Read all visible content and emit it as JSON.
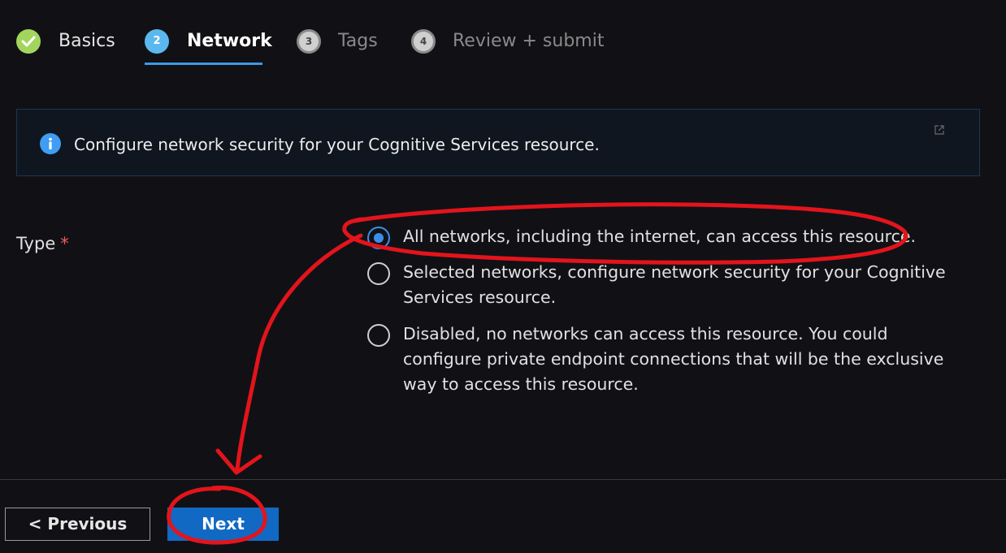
{
  "wizard": {
    "tabs": [
      {
        "label": "Basics",
        "step": "",
        "state": "completed"
      },
      {
        "label": "Network",
        "step": "2",
        "state": "active"
      },
      {
        "label": "Tags",
        "step": "3",
        "state": "upcoming"
      },
      {
        "label": "Review + submit",
        "step": "4",
        "state": "upcoming"
      }
    ]
  },
  "info_banner": {
    "text": "Configure network security for your Cognitive Services resource.",
    "icon": "info-icon",
    "link_icon": "external-link-icon"
  },
  "type_field": {
    "label": "Type",
    "required_marker": "*",
    "options": [
      {
        "label": "All networks, including the internet, can access this resource.",
        "selected": true
      },
      {
        "label": "Selected networks, configure network security for your Cognitive Services resource.",
        "selected": false
      },
      {
        "label": "Disabled, no networks can access this resource. You could configure private endpoint connections that will be the exclusive way to access this resource.",
        "selected": false
      }
    ]
  },
  "footer": {
    "previous_label": "< Previous",
    "next_label": "Next"
  },
  "colors": {
    "background": "#111115",
    "accent_blue": "#1169c4",
    "completed_green": "#a3d55e",
    "active_step_blue": "#5bb8ef",
    "required_red": "#f05c5c",
    "annotation_red": "#e3141c"
  }
}
